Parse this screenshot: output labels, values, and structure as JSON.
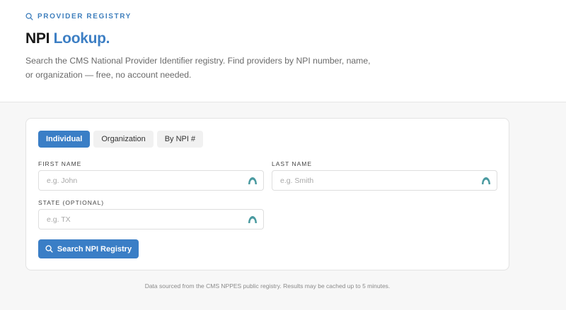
{
  "header": {
    "eyebrow": "PROVIDER REGISTRY",
    "title_main": "NPI",
    "title_accent": "Lookup.",
    "subtitle": "Search the CMS National Provider Identifier registry. Find providers by NPI number, name, or organization — free, no account needed."
  },
  "tabs": [
    {
      "label": "Individual",
      "active": true
    },
    {
      "label": "Organization",
      "active": false
    },
    {
      "label": "By NPI #",
      "active": false
    }
  ],
  "form": {
    "first_name": {
      "label": "FIRST NAME",
      "placeholder": "e.g. John",
      "value": ""
    },
    "last_name": {
      "label": "LAST NAME",
      "placeholder": "e.g. Smith",
      "value": ""
    },
    "state": {
      "label": "STATE (OPTIONAL)",
      "placeholder": "e.g. TX",
      "value": ""
    },
    "submit_label": "Search NPI Registry"
  },
  "footer": {
    "note": "Data sourced from the CMS NPPES public registry. Results may be cached up to 5 minutes."
  },
  "colors": {
    "accent": "#3a7ec6",
    "autofill_icon": "#4a9aa0"
  },
  "icons": {
    "eyebrow": "search-icon",
    "button": "search-icon",
    "field_adornment": "autofill-icon"
  }
}
